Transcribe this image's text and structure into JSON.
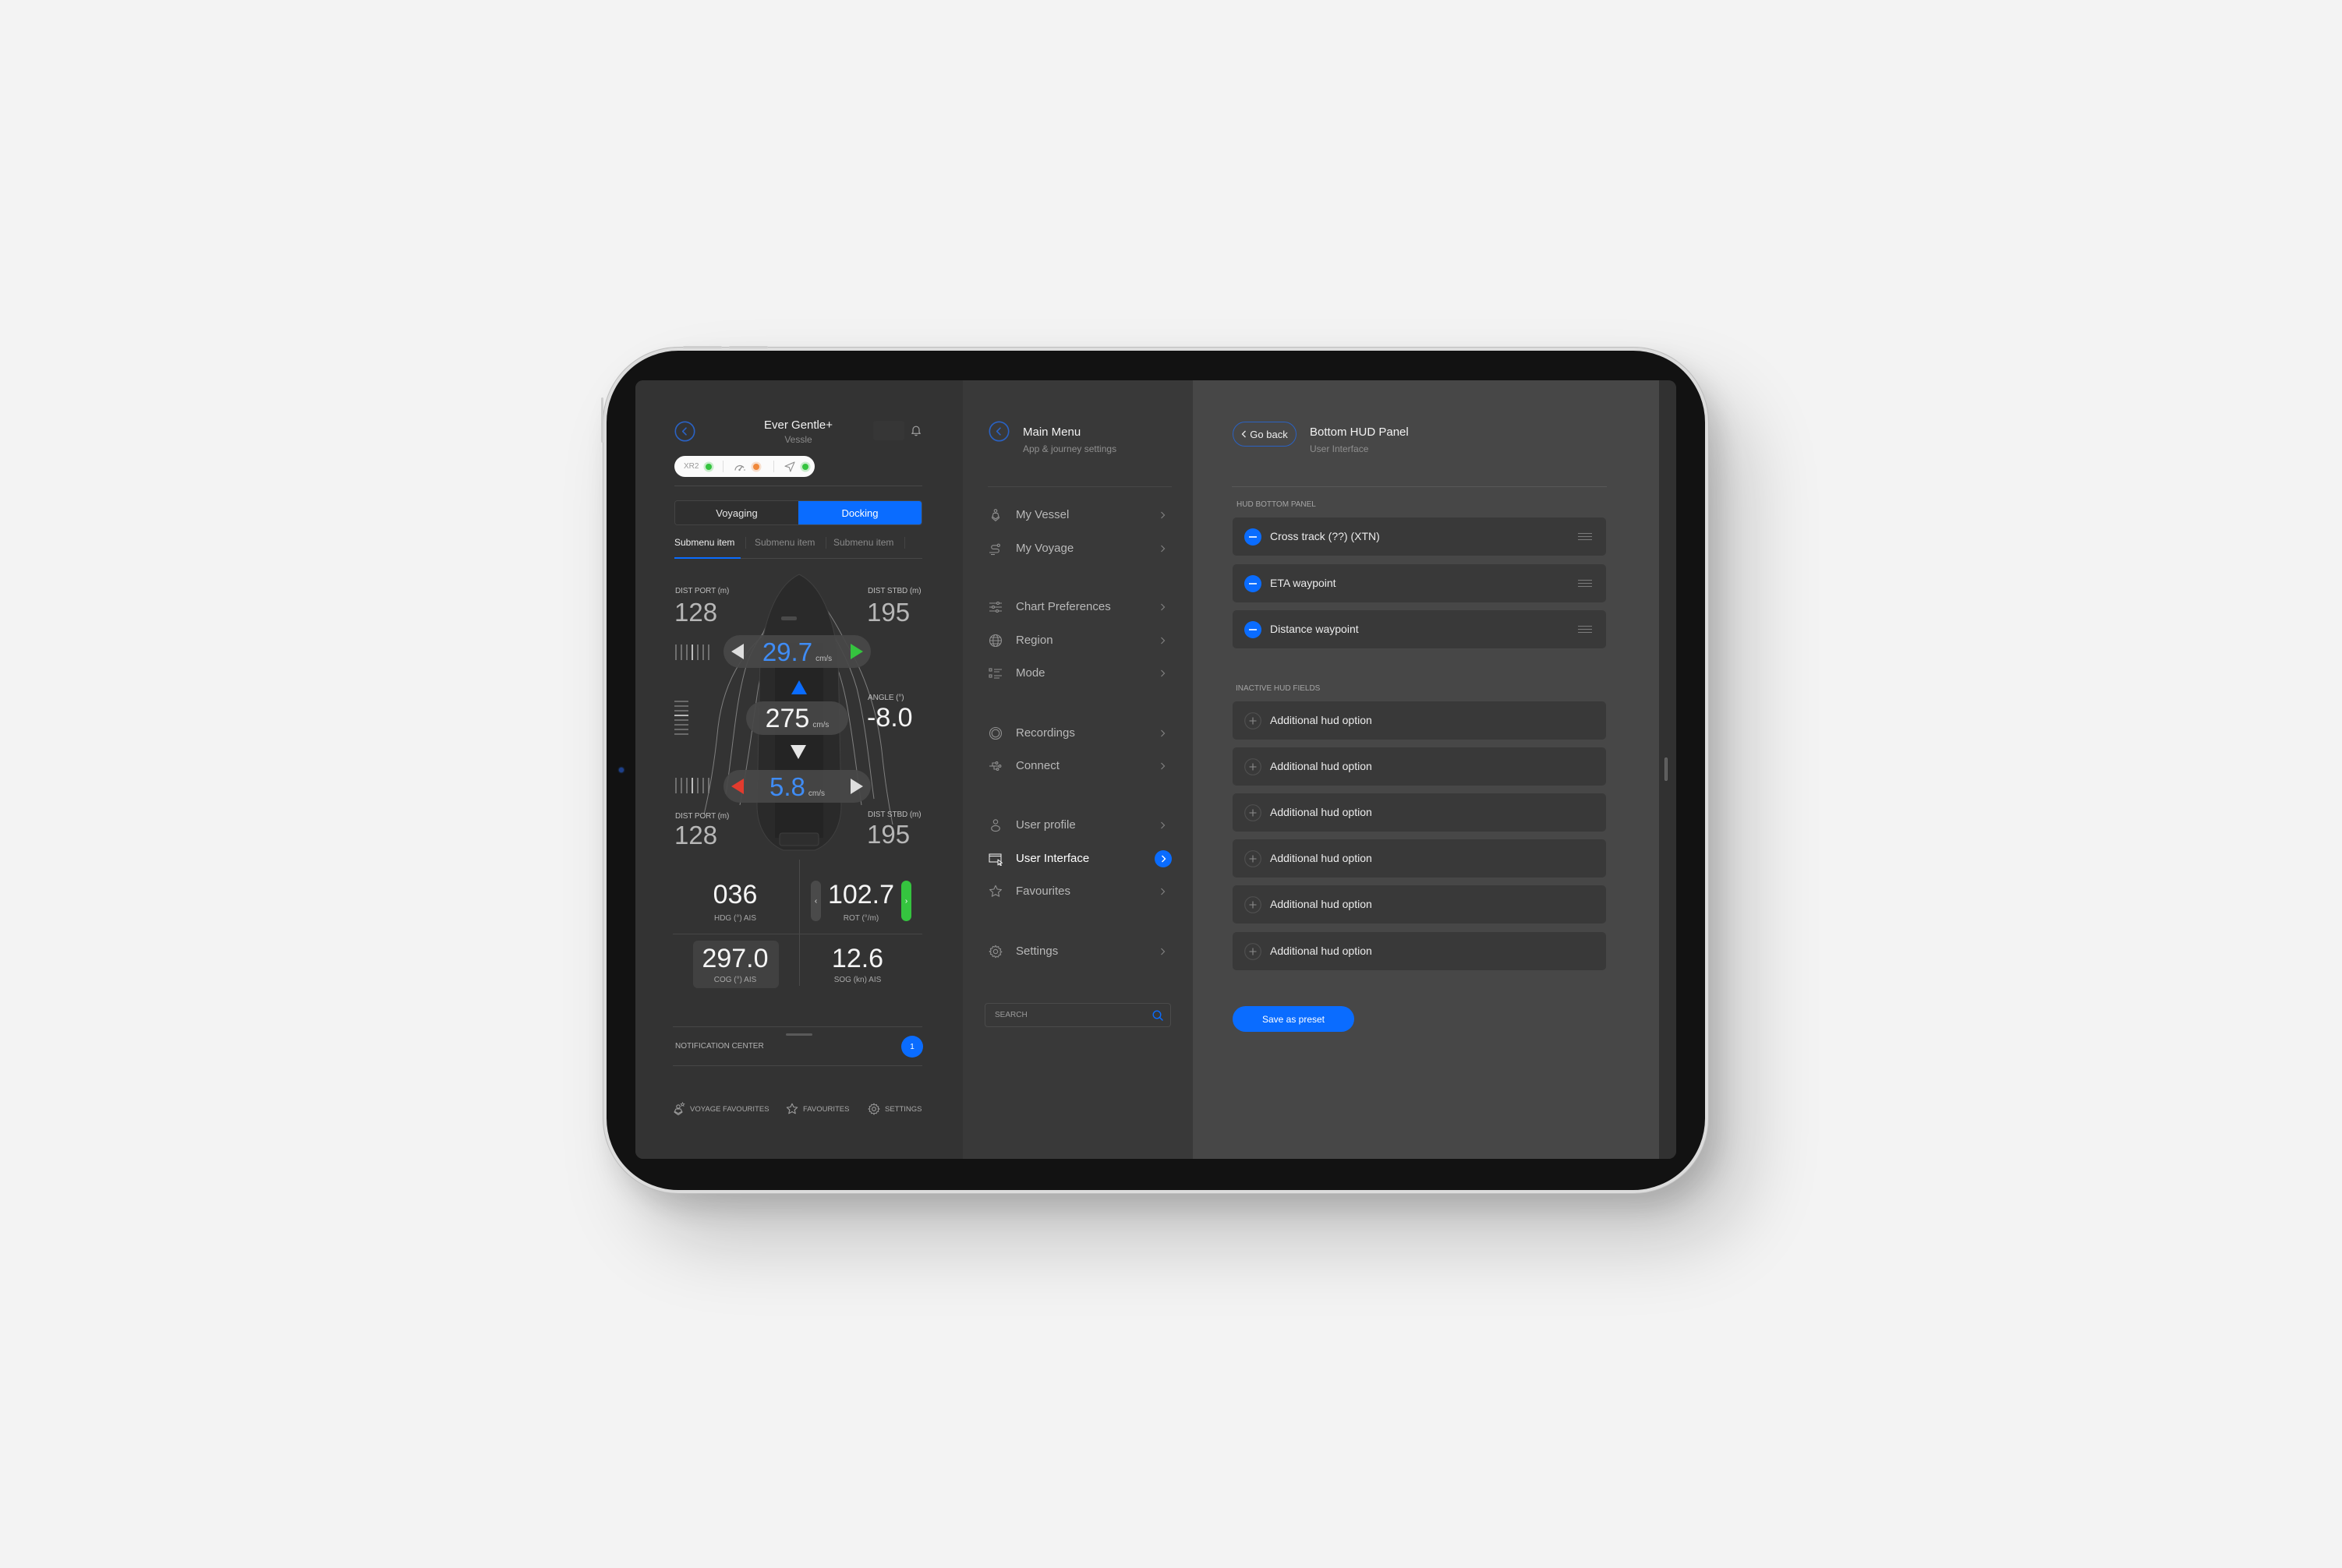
{
  "colors": {
    "accent": "#0a6cff",
    "accent_text": "#3f8cf5",
    "ok": "#35c43f",
    "warn": "#f0883a",
    "alert": "#e23b2e"
  },
  "vessel_panel": {
    "title": "Ever Gentle+",
    "subtitle": "Vessle",
    "status": {
      "device_label": "XR2",
      "indicators": [
        {
          "icon": "device-icon",
          "state": "ok"
        },
        {
          "icon": "speed-gauge-icon",
          "state": "warning"
        },
        {
          "icon": "navigation-arrow-icon",
          "state": "ok"
        }
      ]
    },
    "mode_toggle": [
      {
        "label": "Voyaging",
        "active": false
      },
      {
        "label": "Docking",
        "active": true
      }
    ],
    "submenu": [
      {
        "label": "Submenu item",
        "active": true
      },
      {
        "label": "Submenu item",
        "active": false
      },
      {
        "label": "Submenu item",
        "active": false
      }
    ],
    "docking": {
      "dist_port_fwd": {
        "label": "DIST PORT (m)",
        "value": "128"
      },
      "dist_stbd_fwd": {
        "label": "DIST STBD (m)",
        "value": "195"
      },
      "bow_thruster": {
        "value": "29.7",
        "unit": "cm/s",
        "port_arrow": "inactive",
        "stbd_arrow": "active"
      },
      "speed": {
        "value": "275",
        "unit": "cm/s"
      },
      "angle": {
        "label": "ANGLE (°)",
        "value": "-8.0"
      },
      "stern_thruster": {
        "value": "5.8",
        "unit": "cm/s",
        "port_arrow": "alert",
        "stbd_arrow": "inactive"
      },
      "dist_port_aft": {
        "label": "DIST PORT (m)",
        "value": "128"
      },
      "dist_stbd_aft": {
        "label": "DIST STBD (m)",
        "value": "195"
      }
    },
    "instruments": [
      {
        "value": "036",
        "label": "HDG (°) AIS"
      },
      {
        "value": "102.7",
        "label": "ROT (°/m)"
      },
      {
        "value": "297.0",
        "label": "COG (°) AIS"
      },
      {
        "value": "12.6",
        "label": "SOG (kn) AIS"
      }
    ],
    "rot_prev": "‹",
    "rot_next": "›",
    "notifications": {
      "label": "NOTIFICATION CENTER",
      "count": "1"
    },
    "bottom_nav": [
      {
        "label": "VOYAGE FAVOURITES",
        "icon": "voyage-favourites-icon"
      },
      {
        "label": "FAVOURITES",
        "icon": "star-icon"
      },
      {
        "label": "SETTINGS",
        "icon": "gear-icon"
      }
    ]
  },
  "main_menu": {
    "title": "Main Menu",
    "subtitle": "App & journey settings",
    "items": [
      {
        "label": "My Vessel",
        "icon": "vessel-icon",
        "active": false
      },
      {
        "label": "My Voyage",
        "icon": "route-icon",
        "active": false
      },
      {
        "label": "Chart Preferences",
        "icon": "sliders-icon",
        "active": false
      },
      {
        "label": "Region",
        "icon": "globe-icon",
        "active": false
      },
      {
        "label": "Mode",
        "icon": "list-icon",
        "active": false
      },
      {
        "label": "Recordings",
        "icon": "record-icon",
        "active": false
      },
      {
        "label": "Connect",
        "icon": "connect-icon",
        "active": false
      },
      {
        "label": "User profile",
        "icon": "user-icon",
        "active": false
      },
      {
        "label": "User Interface",
        "icon": "window-cursor-icon",
        "active": true
      },
      {
        "label": "Favourites",
        "icon": "star-icon",
        "active": false
      },
      {
        "label": "Settings",
        "icon": "gear-icon",
        "active": false
      }
    ],
    "search_placeholder": "SEARCH"
  },
  "hud_panel": {
    "back_label": "Go back",
    "title": "Bottom HUD Panel",
    "breadcrumb": "User Interface",
    "active_section_label": "HUD BOTTOM PANEL",
    "active_fields": [
      {
        "label": "Cross track (??) (XTN)"
      },
      {
        "label": "ETA waypoint"
      },
      {
        "label": "Distance waypoint"
      }
    ],
    "inactive_section_label": "INACTIVE HUD FIELDS",
    "inactive_fields": [
      {
        "label": "Additional hud option"
      },
      {
        "label": "Additional hud option"
      },
      {
        "label": "Additional hud option"
      },
      {
        "label": "Additional hud option"
      },
      {
        "label": "Additional hud option"
      },
      {
        "label": "Additional hud option"
      }
    ],
    "save_label": "Save as preset"
  }
}
